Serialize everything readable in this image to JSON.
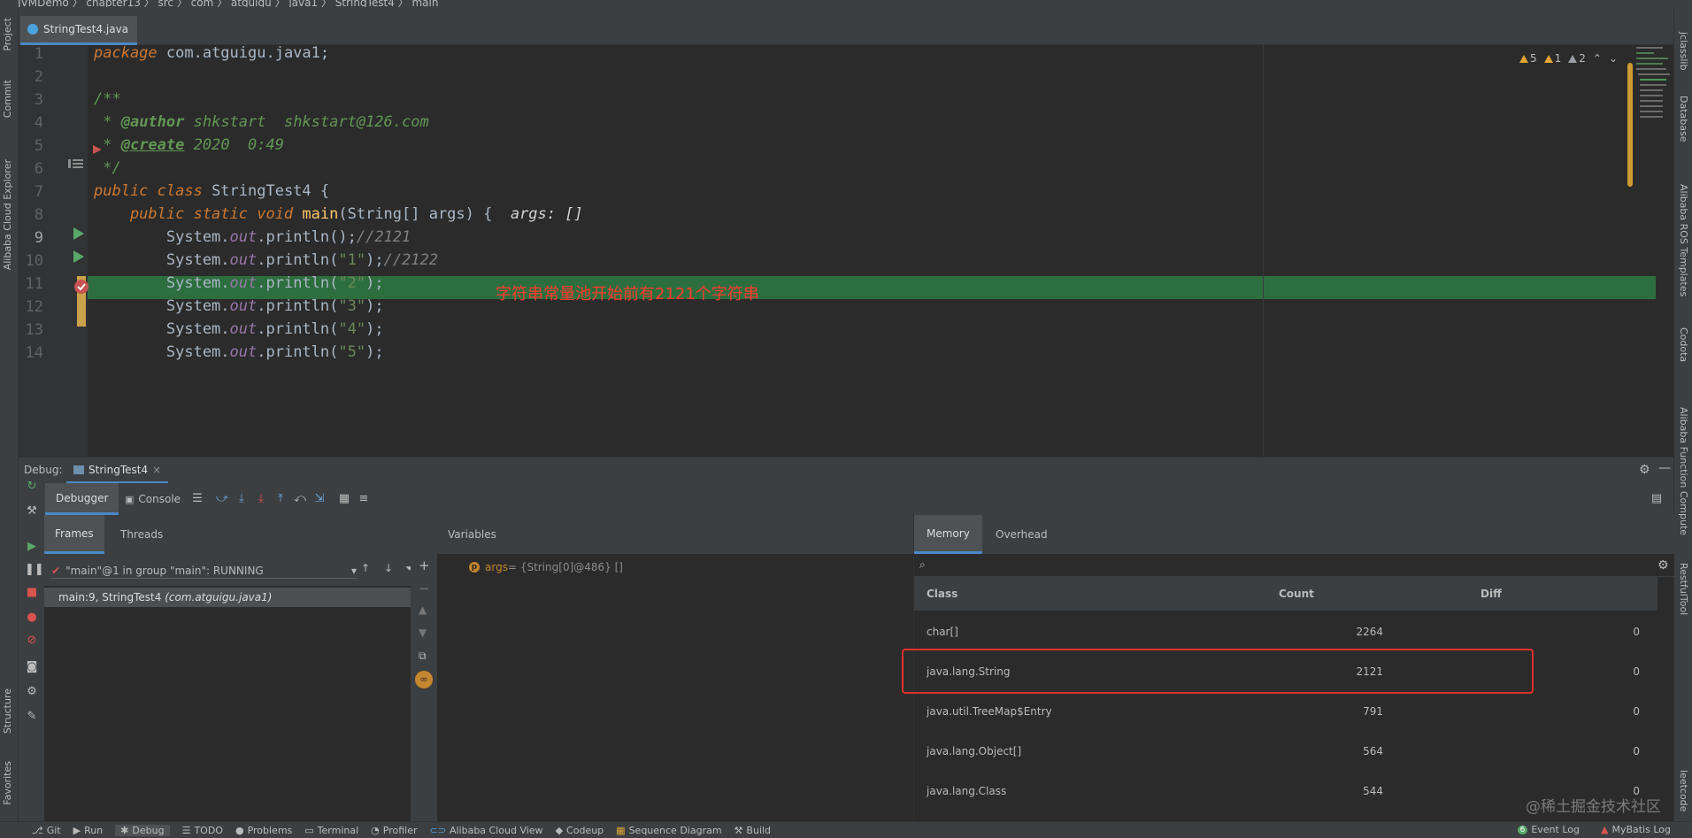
{
  "navbar": {
    "crumb": "JVMDemo  〉 chapter13  〉 src  〉 com  〉 atguigu  〉 java1  〉 StringTest4  〉 main"
  },
  "left_strip": {
    "project": "Project",
    "commit": "Commit",
    "alibaba": "Alibaba Cloud Explorer",
    "structure": "Structure",
    "favorites": "Favorites"
  },
  "right_strip": {
    "jclasslib": "jclasslib",
    "database": "Database",
    "ros": "Alibaba ROS Templates",
    "codota": "Codota",
    "fc": "Alibaba Function Compute",
    "restful": "RestfulTool",
    "leetcode": "leetcode"
  },
  "editor": {
    "tab_label": "StringTest4.java",
    "inspection": {
      "warn_count": "5",
      "weak_warn_count": "1",
      "typo_count": "2"
    },
    "line_numbers": [
      "1",
      "2",
      "3",
      "4",
      "5",
      "6",
      "7",
      "8",
      "9",
      "10",
      "11",
      "12",
      "13",
      "14"
    ],
    "current_line": "9",
    "lines": {
      "l1_kw": "package",
      "l1_rest": " com.atguigu.java1;",
      "l3": "/**",
      "l4_pre": " * ",
      "l4_tag": "@author",
      "l4_rest": " shkstart  shkstart@126.com",
      "l5_pre": " * ",
      "l5_tag": "@create",
      "l5_rest": " 2020  0:49",
      "l6": " */",
      "l7_kw": "public class",
      "l7_rest": " StringTest4 {",
      "l8_kw": "    public static void",
      "l8_fn": " main",
      "l8_rest": "(String[] args) {",
      "l8_hint": "  args: []",
      "print_prefix": "        System.",
      "out": "out",
      "println": ".println(",
      "l9_args": ");",
      "l9_comment": "//2121",
      "l10_str": "\"1\"",
      "l10_end": ");",
      "l10_comment": "//2122",
      "l11_str": "\"2\"",
      "l12_str": "\"3\"",
      "l13_str": "\"4\"",
      "l14_str": "\"5\"",
      "close": ");"
    }
  },
  "annotation": "字符串常量池开始前有2121个字符串",
  "debug": {
    "label": "Debug:",
    "tab": "StringTest4",
    "debugger_tab": "Debugger",
    "console_tab": "Console",
    "frames_tab": "Frames",
    "threads_tab": "Threads",
    "thread_value": "\"main\"@1 in group \"main\": RUNNING",
    "frame_text": "main:9, StringTest4",
    "frame_pkg": "(com.atguigu.java1)",
    "variables_title": "Variables",
    "var_name": "args",
    "var_value": " = {String[0]@486} []"
  },
  "memory": {
    "memory_tab": "Memory",
    "overhead_tab": "Overhead",
    "columns": {
      "class": "Class",
      "count": "Count",
      "diff": "Diff"
    },
    "rows": [
      {
        "cls": "char[]",
        "count": "2264",
        "diff": "0"
      },
      {
        "cls": "java.lang.String",
        "count": "2121",
        "diff": "0"
      },
      {
        "cls": "java.util.TreeMap$Entry",
        "count": "791",
        "diff": "0"
      },
      {
        "cls": "java.lang.Object[]",
        "count": "564",
        "diff": "0"
      },
      {
        "cls": "java.lang.Class",
        "count": "544",
        "diff": "0"
      }
    ]
  },
  "statusbar": {
    "git": "Git",
    "run": "Run",
    "debug": "Debug",
    "todo": "TODO",
    "problems": "Problems",
    "terminal": "Terminal",
    "profiler": "Profiler",
    "alibaba": "Alibaba Cloud View",
    "codeup": "Codeup",
    "seq": "Sequence Diagram",
    "build": "Build",
    "event_log_count": "6",
    "event_log": "Event Log",
    "mybatis": "MyBatis Log"
  },
  "watermark": "@稀土掘金技术社区",
  "colors": {
    "accent": "#4a88c7",
    "exec_line": "#2d6e3e",
    "highlight": "#e0302c",
    "annotation": "#ff3a2f"
  }
}
